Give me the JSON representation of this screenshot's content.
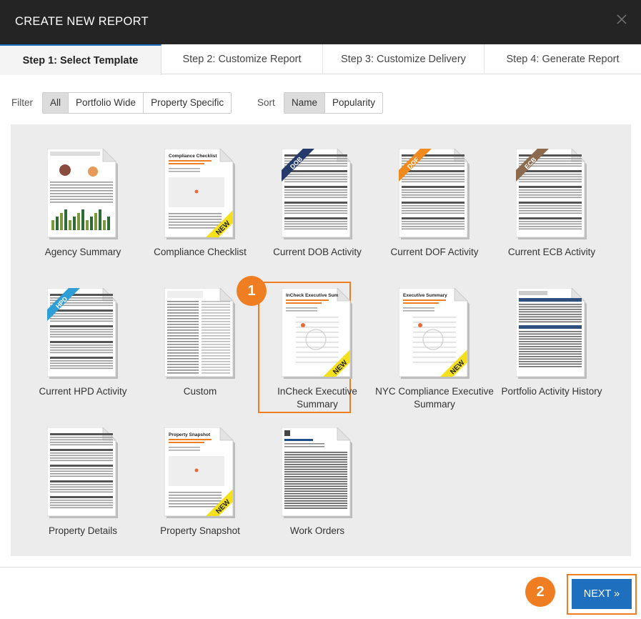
{
  "header": {
    "title": "CREATE NEW REPORT",
    "close_icon": "close-icon"
  },
  "tabs": [
    {
      "label": "Step 1: Select Template",
      "active": true
    },
    {
      "label": "Step 2: Customize Report"
    },
    {
      "label": "Step 3: Customize Delivery"
    },
    {
      "label": "Step 4: Generate Report"
    }
  ],
  "filter": {
    "label": "Filter",
    "options": [
      "All",
      "Portfolio Wide",
      "Property Specific"
    ],
    "selected": "All"
  },
  "sort": {
    "label": "Sort",
    "options": [
      "Name",
      "Popularity"
    ],
    "selected": "Name"
  },
  "templates": [
    {
      "label": "Agency Summary",
      "corner": "",
      "new": false
    },
    {
      "label": "Compliance Checklist",
      "corner": "",
      "new": true,
      "thumb_title": "Compliance Checklist"
    },
    {
      "label": "Current DOB Activity",
      "corner": "DOB",
      "corner_color": "#233a6b",
      "new": false
    },
    {
      "label": "Current DOF Activity",
      "corner": "DOF",
      "corner_color": "#ef8a1f",
      "new": false
    },
    {
      "label": "Current ECB Activity",
      "corner": "ECB",
      "corner_color": "#8b6a4e",
      "new": false
    },
    {
      "label": "Current HPD Activity",
      "corner": "HPD",
      "corner_color": "#2d9fd6",
      "new": false
    },
    {
      "label": "Custom",
      "corner": "",
      "new": false
    },
    {
      "label": "InCheck Executive Summary",
      "corner": "",
      "new": true,
      "selected": true,
      "thumb_title": "InCheck Executive Sum"
    },
    {
      "label": "NYC Compliance Executive Summary",
      "corner": "",
      "new": true,
      "thumb_title": "Executive Summary"
    },
    {
      "label": "Portfolio Activity History",
      "corner": "",
      "new": false
    },
    {
      "label": "Property Details",
      "corner": "",
      "new": false
    },
    {
      "label": "Property Snapshot",
      "corner": "",
      "new": true,
      "thumb_title": "Property Snapshot"
    },
    {
      "label": "Work Orders",
      "corner": "",
      "new": false
    }
  ],
  "new_ribbon_text": "NEW",
  "annotations": {
    "step1": "1",
    "step2": "2"
  },
  "next_button": {
    "label": "NEXT »"
  },
  "colors": {
    "accent": "#1f6fbf",
    "highlight": "#ef7d22",
    "ribbon": "#f4e01c"
  }
}
